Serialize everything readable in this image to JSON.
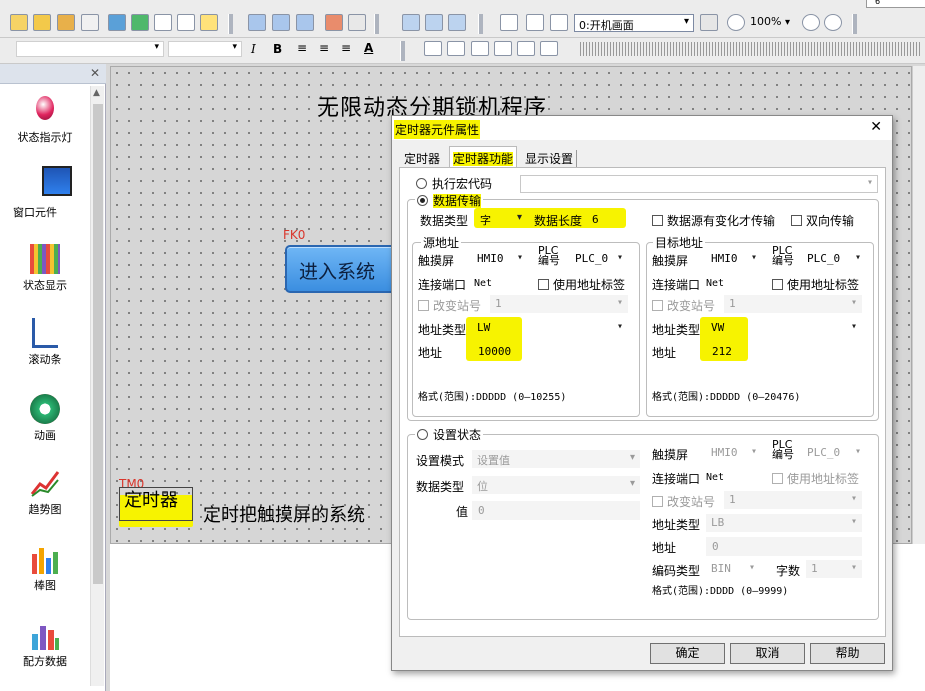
{
  "toolbar": {
    "screen_select": "0:开机画面",
    "zoom": "100%",
    "corner_label": "6"
  },
  "panel": {
    "items": [
      {
        "label": "状态指示灯",
        "icon": "indicator-light-icon"
      },
      {
        "label": "窗口元件",
        "icon": "window-icon"
      },
      {
        "label": "状态显示",
        "icon": "status-bars-icon"
      },
      {
        "label": "滚动条",
        "icon": "scrollbar-icon"
      },
      {
        "label": "动画",
        "icon": "animation-icon"
      },
      {
        "label": "趋势图",
        "icon": "trend-chart-icon"
      },
      {
        "label": "棒图",
        "icon": "bar-chart-icon"
      },
      {
        "label": "配方数据",
        "icon": "recipe-icon"
      }
    ]
  },
  "canvas": {
    "title": "无限动态分期锁机程序",
    "button_tag": "FK0",
    "button_label": "进入系统",
    "timer_tag": "TM0",
    "timer_label": "定时器",
    "note": "定时把触摸屏的系统"
  },
  "dialog": {
    "title": "定时器元件属性",
    "tabs": [
      "定时器",
      "定时器功能",
      "显示设置"
    ],
    "macro_radio": "执行宏代码",
    "transfer_radio": "数据传输",
    "data_type_label": "数据类型",
    "data_type_value": "字",
    "data_length_label": "数据长度",
    "data_length_value": "6",
    "transfer_on_change": "数据源有变化才传输",
    "bidirectional": "双向传输",
    "source": {
      "title": "源地址",
      "screen_label": "触摸屏",
      "screen_value": "HMI0",
      "plc_label": "PLC编号",
      "plc_value": "PLC_0",
      "port_label": "连接端口",
      "port_value": "Net",
      "use_tag": "使用地址标签",
      "change_station": "改变站号",
      "station_value": "1",
      "addr_type_label": "地址类型",
      "addr_type_value": "LW",
      "addr_label": "地址",
      "addr_value": "10000",
      "format": "格式(范围):DDDDD (0—10255)"
    },
    "target": {
      "title": "目标地址",
      "screen_label": "触摸屏",
      "screen_value": "HMI0",
      "plc_label": "PLC编号",
      "plc_value": "PLC_0",
      "port_label": "连接端口",
      "port_value": "Net",
      "use_tag": "使用地址标签",
      "change_station": "改变站号",
      "station_value": "1",
      "addr_type_label": "地址类型",
      "addr_type_value": "VW",
      "addr_label": "地址",
      "addr_value": "212",
      "format": "格式(范围):DDDDD (0—20476)"
    },
    "set_state": {
      "radio": "设置状态",
      "mode_label": "设置模式",
      "mode_value": "设置值",
      "dtype_label": "数据类型",
      "dtype_value": "位",
      "value_label": "值",
      "value_value": "0",
      "screen_label": "触摸屏",
      "screen_value": "HMI0",
      "plc_label": "PLC编号",
      "plc_value": "PLC_0",
      "port_label": "连接端口",
      "port_value": "Net",
      "use_tag": "使用地址标签",
      "change_station": "改变站号",
      "station_value": "1",
      "addr_type_label": "地址类型",
      "addr_type_value": "LB",
      "addr_label": "地址",
      "addr_value": "0",
      "code_label": "编码类型",
      "code_value": "BIN",
      "words_label": "字数",
      "words_value": "1",
      "format": "格式(范围):DDDD (0—9999)"
    },
    "ok": "确定",
    "cancel": "取消",
    "help": "帮助"
  }
}
